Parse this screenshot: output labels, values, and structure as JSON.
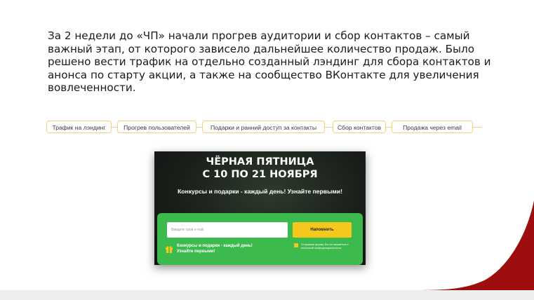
{
  "intro_text": "За 2 недели до «ЧП» начали прогрев аудитории и сбор контактов – самый важный этап, от которого зависело дальнейшее количество продаж. Было решено вести трафик на отдельно созданный лэндинг для сбора контактов и анонса по старту акции, а также на сообщество ВКонтакте для увеличения вовлеченности.",
  "flow_steps": [
    "Трафик на лэндинг",
    "Прогрев пользователей",
    "Подарки и ранний доступ за контакты",
    "Сбор контактов",
    "Продажа через email"
  ],
  "promo": {
    "title_line1": "ЧЁРНАЯ ПЯТНИЦА",
    "title_line2": "С 10 ПО 21 НОЯБРЯ",
    "subtitle": "Конкурсы и подарки - каждый день! Узнайте первыми!",
    "email_placeholder": "Введите свой e-mail",
    "remind_button": "Напомнить",
    "gift_note": "Конкурсы и подарки - каждый день! Узнайте первыми!",
    "consent_text": "Отправляя форму, Вы соглашаетесь с политикой конфиденциальности"
  },
  "colors": {
    "accent_red": "#9e0e0e",
    "promo_green": "#3cba4d",
    "button_yellow": "#f6c81b",
    "step_border": "#f2d27a"
  }
}
